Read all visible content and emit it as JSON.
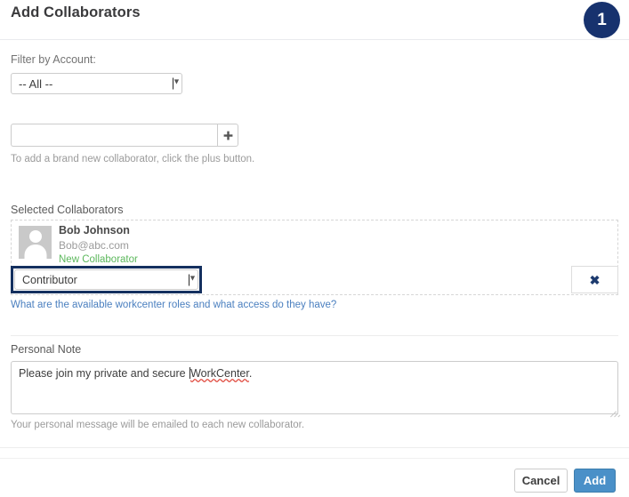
{
  "header": {
    "title": "Add Collaborators",
    "step_badge": "1",
    "badge_color": "#17326e"
  },
  "filter": {
    "label": "Filter by Account:",
    "selected": "-- All --",
    "options": [
      "-- All --"
    ],
    "caret_icon": "chevron-down-icon"
  },
  "new_collaborator": {
    "input_value": "",
    "placeholder": "",
    "plus_icon": "plus-icon",
    "help_text": "To add a brand new collaborator, click the plus button."
  },
  "selected_collaborators": {
    "label": "Selected Collaborators",
    "rows": [
      {
        "avatar_icon": "user-avatar-placeholder-icon",
        "name": "Bob Johnson",
        "email": "Bob@abc.com",
        "status": "New Collaborator",
        "status_color": "#5cb85c",
        "role_selected": "Contributor",
        "role_options": [
          "Contributor"
        ],
        "role_caret_icon": "chevron-down-icon",
        "remove_icon": "close-icon",
        "remove_glyph": "✖",
        "highlight_color": "#14305f"
      }
    ],
    "roles_link": "What are the available workcenter roles and what access do they have?"
  },
  "personal_note": {
    "label": "Personal Note",
    "value": "Please join my private and secure WorkCenter.",
    "text_before_caret": "Please join my private and secure ",
    "misspelled_word": "WorkCenter",
    "text_after": ".",
    "help_text": "Your personal message will be emailed to each new collaborator.",
    "spellcheck_underline_color": "#e04a3f"
  },
  "footer": {
    "cancel_label": "Cancel",
    "add_label": "Add",
    "add_color": "#4a90c8"
  }
}
